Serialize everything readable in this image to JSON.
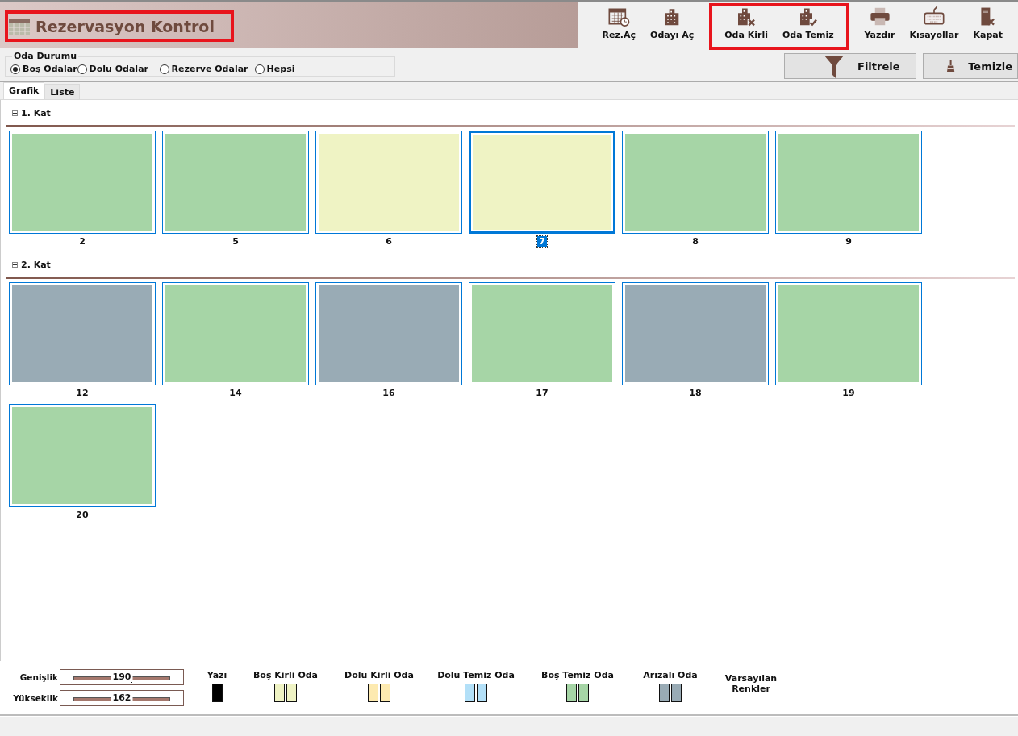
{
  "title": {
    "text": "Rezervasyon Kontrol",
    "highlighted": true
  },
  "toolbar_groups": [
    {
      "highlighted": false,
      "buttons": [
        {
          "label": "Rez.Aç"
        },
        {
          "label": "Odayı Aç"
        }
      ]
    },
    {
      "highlighted": true,
      "buttons": [
        {
          "label": "Oda Kirli"
        },
        {
          "label": "Oda Temiz"
        }
      ]
    },
    {
      "highlighted": false,
      "buttons": [
        {
          "label": "Yazdır"
        },
        {
          "label": "Kısayollar"
        },
        {
          "label": "Kapat"
        }
      ]
    }
  ],
  "room_status": {
    "legend": "Oda Durumu",
    "options": [
      {
        "label": "Boş Odalar",
        "selected": true
      },
      {
        "label": "Dolu Odalar",
        "selected": false
      },
      {
        "label": "Rezerve Odalar",
        "selected": false
      },
      {
        "label": "Hepsi",
        "selected": false
      }
    ]
  },
  "actions": [
    {
      "label": "Filtrele"
    },
    {
      "label": "Temizle"
    }
  ],
  "tabs": [
    {
      "label": "Grafik",
      "selected": true
    },
    {
      "label": "Liste",
      "selected": false
    }
  ],
  "floors": [
    {
      "name": "1. Kat",
      "expanded": true,
      "rooms": [
        {
          "number": "2",
          "color": "#a6d5a6",
          "selected": false
        },
        {
          "number": "5",
          "color": "#a6d5a6",
          "selected": false
        },
        {
          "number": "6",
          "color": "#eff3c4",
          "selected": false
        },
        {
          "number": "7",
          "color": "#eff3c4",
          "selected": true
        },
        {
          "number": "8",
          "color": "#a6d5a6",
          "selected": false
        },
        {
          "number": "9",
          "color": "#a6d5a6",
          "selected": false
        }
      ]
    },
    {
      "name": "2. Kat",
      "expanded": true,
      "rooms": [
        {
          "number": "12",
          "color": "#99abb5",
          "selected": false
        },
        {
          "number": "14",
          "color": "#a6d5a6",
          "selected": false
        },
        {
          "number": "16",
          "color": "#99abb5",
          "selected": false
        },
        {
          "number": "17",
          "color": "#a6d5a6",
          "selected": false
        },
        {
          "number": "18",
          "color": "#99abb5",
          "selected": false
        },
        {
          "number": "19",
          "color": "#a6d5a6",
          "selected": false
        },
        {
          "number": "20",
          "color": "#a6d5a6",
          "selected": false
        }
      ]
    }
  ],
  "sliders": [
    {
      "label": "Genişlik",
      "reading": "190",
      "level": 0.6
    },
    {
      "label": "Yükseklik",
      "reading": "162",
      "level": 0.47
    }
  ],
  "legend": [
    {
      "label": "Yazı",
      "kind": "single",
      "color": "#000000"
    },
    {
      "label": "Boş Kirli Oda",
      "kind": "pair",
      "color": "#eff3c4"
    },
    {
      "label": "Dolu Kirli Oda",
      "kind": "pair",
      "color": "#fdeab0"
    },
    {
      "label": "Dolu Temiz Oda",
      "kind": "pair",
      "color": "#b3e0f8"
    },
    {
      "label": "Boş Temiz Oda",
      "kind": "pair",
      "color": "#a6d5a6"
    },
    {
      "label": "Arızalı Oda",
      "kind": "pair",
      "color": "#99abb5"
    }
  ],
  "defaults_button": "Varsayılan Renkler"
}
